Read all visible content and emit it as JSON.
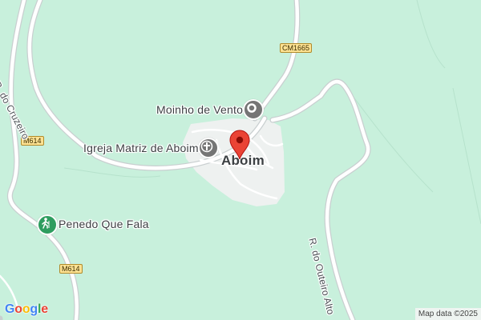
{
  "colors": {
    "land": "#c8f0dc",
    "road": "#ffffff",
    "road_outline": "#c9cfd0",
    "settlement": "#eef1f0",
    "pin": "#ea4335",
    "church_poi": "#757575",
    "park_poi": "#2e9d5f"
  },
  "places": {
    "town": "Aboim",
    "church": "Igreja Matriz de Aboim",
    "mill": "Moinho de Vento",
    "park": "Penedo Que Fala"
  },
  "streets": {
    "cruzeiro": "R. do Cruzeiro",
    "outeiro": "R. do Outeiro Alto"
  },
  "road_shields": {
    "cm1665": "CM1665",
    "m614_top": "M614",
    "m614_bottom": "M614"
  },
  "icons": {
    "pin": "location-pin-icon",
    "church": "church-icon",
    "mill": "landmark-icon",
    "park": "hiking-icon"
  },
  "footer": {
    "attribution": "Map data ©2025",
    "logo_letters": [
      "G",
      "o",
      "o",
      "g",
      "l",
      "e"
    ]
  }
}
